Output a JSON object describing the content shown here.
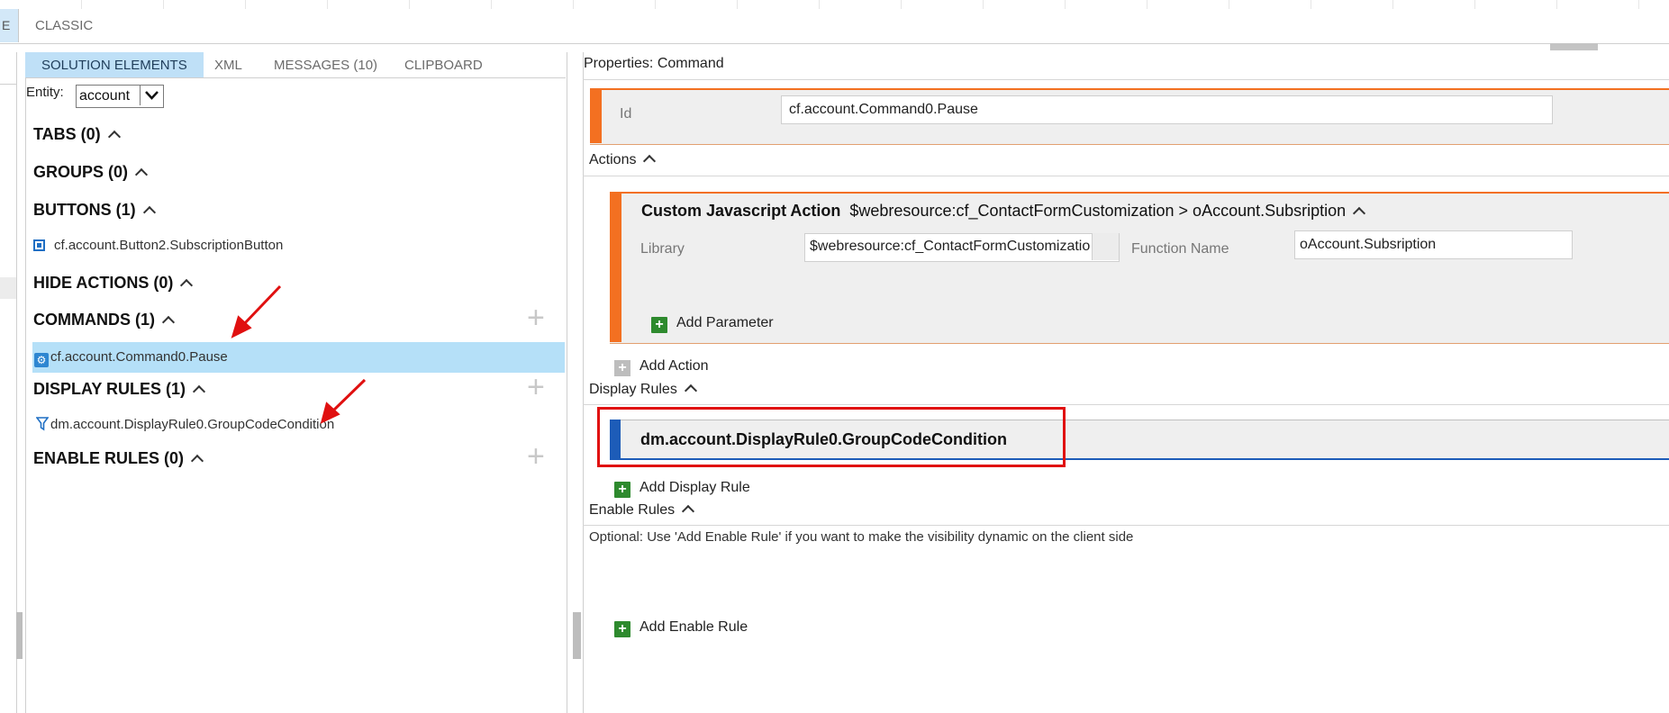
{
  "top_tabs": {
    "left_tab_fragment": "E",
    "classic_label": "CLASSIC"
  },
  "middle_pane": {
    "tabs": [
      {
        "label": "SOLUTION ELEMENTS",
        "active": true
      },
      {
        "label": "XML",
        "active": false
      },
      {
        "label": "MESSAGES (10)",
        "active": false
      },
      {
        "label": "CLIPBOARD",
        "active": false
      }
    ],
    "entity_label": "Entity:",
    "entity_value": "account",
    "sections": {
      "tabs": "TABS (0)",
      "groups": "GROUPS (0)",
      "buttons": "BUTTONS (1)",
      "hide_actions": "HIDE ACTIONS (0)",
      "commands": "COMMANDS (1)",
      "display_rules": "DISPLAY RULES (1)",
      "enable_rules": "ENABLE RULES (0)"
    },
    "items": {
      "button": "cf.account.Button2.SubscriptionButton",
      "command": "cf.account.Command0.Pause",
      "display_rule": "dm.account.DisplayRule0.GroupCodeCondition"
    },
    "add_symbol": "+"
  },
  "right_pane": {
    "title": "Properties: Command",
    "id_label": "Id",
    "id_value": "cf.account.Command0.Pause",
    "actions_label": "Actions",
    "action": {
      "title_bold": "Custom Javascript Action",
      "title_rest": "$webresource:cf_ContactFormCustomization > oAccount.Subsription",
      "library_label": "Library",
      "library_value": "$webresource:cf_ContactFormCustomization",
      "function_label": "Function Name",
      "function_value": "oAccount.Subsription",
      "add_parameter": "Add Parameter"
    },
    "add_action": "Add Action",
    "display_rules_label": "Display Rules",
    "display_rule_title": "dm.account.DisplayRule0.GroupCodeCondition",
    "add_display_rule": "Add Display Rule",
    "enable_rules_label": "Enable Rules",
    "enable_rules_hint": "Optional: Use 'Add Enable Rule' if you want to make the visibility dynamic on the client side",
    "add_enable_rule": "Add Enable Rule",
    "plus_symbol": "+"
  },
  "colors": {
    "accent_orange": "#f37021",
    "accent_blue": "#1d5cb8",
    "selection_blue": "#b5e0f8",
    "annotation_red": "#e01010",
    "add_green": "#2e8a2e"
  }
}
